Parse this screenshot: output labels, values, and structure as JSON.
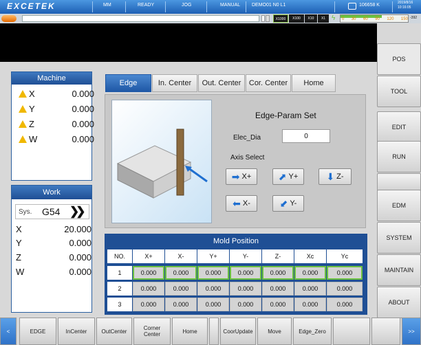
{
  "topbar": {
    "brand": "EXCETEK",
    "items": [
      "MM",
      "READY",
      "JOG",
      "MANUAL",
      "DEMO01 N0 L1"
    ],
    "counter": "106658 K",
    "date": "2019/8/16",
    "time": "10:16:05"
  },
  "scale": {
    "buttons": [
      "X1000",
      "X100",
      "X10",
      "X1"
    ],
    "ticks": [
      "0",
      "30",
      "60",
      "90",
      "120",
      "150"
    ],
    "right": "-392"
  },
  "sidebar": [
    "POS",
    "TOOL",
    "EDIT",
    "RUN",
    "EDM",
    "SYSTEM",
    "MAINTAIN",
    "ABOUT"
  ],
  "machine": {
    "title": "Machine",
    "axes": [
      {
        "name": "X",
        "value": "0.000"
      },
      {
        "name": "Y",
        "value": "0.000"
      },
      {
        "name": "Z",
        "value": "0.000"
      },
      {
        "name": "W",
        "value": "0.000"
      }
    ]
  },
  "work": {
    "title": "Work",
    "sys_label": "Sys.",
    "sys_value": "G54",
    "axes": [
      {
        "name": "X",
        "value": "20.000"
      },
      {
        "name": "Y",
        "value": "0.000"
      },
      {
        "name": "Z",
        "value": "0.000"
      },
      {
        "name": "W",
        "value": "0.000"
      }
    ]
  },
  "tabs": [
    "Edge",
    "In. Center",
    "Out. Center",
    "Cor. Center",
    "Home"
  ],
  "edge": {
    "title": "Edge-Param Set",
    "elec_label": "Elec_Dia",
    "elec_value": "0",
    "axis_label": "Axis Select",
    "buttons": [
      "X+",
      "Y+",
      "Z-",
      "X-",
      "Y-"
    ]
  },
  "mold": {
    "title": "Mold Position",
    "headers": [
      "NO.",
      "X+",
      "X-",
      "Y+",
      "Y-",
      "Z-",
      "Xc",
      "Yc"
    ],
    "rows": [
      [
        "1",
        "0.000",
        "0.000",
        "0.000",
        "0.000",
        "0.000",
        "0.000",
        "0.000"
      ],
      [
        "2",
        "0.000",
        "0.000",
        "0.000",
        "0.000",
        "0.000",
        "0.000",
        "0.000"
      ],
      [
        "3",
        "0.000",
        "0.000",
        "0.000",
        "0.000",
        "0.000",
        "0.000",
        "0.000"
      ]
    ]
  },
  "bottom": [
    "EDGE",
    "InCenter",
    "OutCenter",
    "Corner\nCenter",
    "Home",
    "",
    "CoorUpdate",
    "Move",
    "Edge_Zero",
    "",
    ""
  ]
}
